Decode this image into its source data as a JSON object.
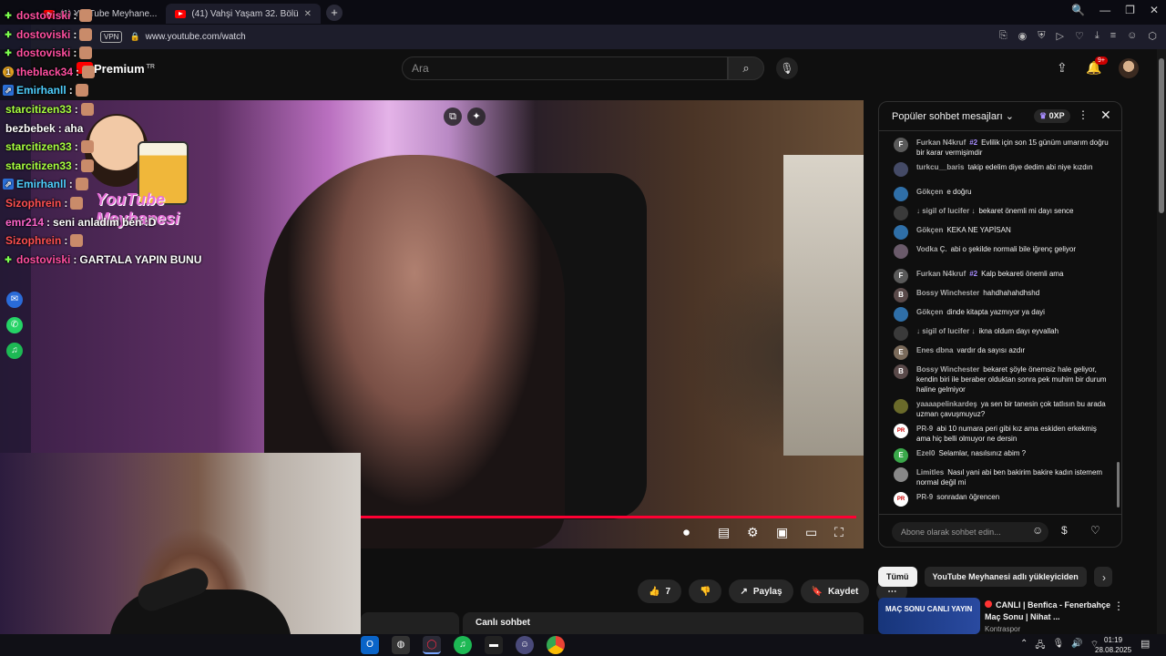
{
  "browser": {
    "tabs": [
      {
        "label": "(1) YouTube Meyhane...",
        "active": false
      },
      {
        "label": "(41) Vahşi Yaşam 32. Bölü",
        "active": true
      }
    ],
    "new_tab": "+",
    "vpn": "VPN",
    "url": "www.youtube.com/watch",
    "window_controls": [
      "🔍",
      "—",
      "❐",
      "✕"
    ]
  },
  "yt_header": {
    "brand": "Premium",
    "region": "TR",
    "search_placeholder": "Ara",
    "notifications_badge": "9+"
  },
  "overlay_chat": [
    {
      "user": "dostoviski",
      "msg": "",
      "color": "#ff4fa0",
      "badge": "plus"
    },
    {
      "user": "dostoviski",
      "msg": "",
      "color": "#ff4fa0",
      "badge": "plus"
    },
    {
      "user": "dostoviski",
      "msg": "",
      "color": "#ff4fa0",
      "badge": "plus"
    },
    {
      "user": "theblack34",
      "msg": "",
      "color": "#ff4fa0",
      "badge": "1"
    },
    {
      "user": "Emirhanll",
      "msg": "",
      "color": "#4fd0ff",
      "badge": "prime"
    },
    {
      "user": "starcitizen33",
      "msg": "",
      "color": "#a8ff40",
      "badge": ""
    },
    {
      "user": "bezbebek",
      "msg": "aha",
      "color": "#ffffff",
      "badge": ""
    },
    {
      "user": "starcitizen33",
      "msg": "",
      "color": "#a8ff40",
      "badge": ""
    },
    {
      "user": "starcitizen33",
      "msg": "",
      "color": "#a8ff40",
      "badge": ""
    },
    {
      "user": "Emirhanll",
      "msg": "",
      "color": "#4fd0ff",
      "badge": "prime"
    },
    {
      "user": "Sizophrein",
      "msg": "",
      "color": "#ff5050",
      "badge": ""
    },
    {
      "user": "emr214",
      "msg": "seni anladım ben :D",
      "color": "#ff66cc",
      "badge": ""
    },
    {
      "user": "Sizophrein",
      "msg": "",
      "color": "#ff5050",
      "badge": ""
    },
    {
      "user": "dostoviski",
      "msg": "GARTALA YAPIN BUNU",
      "color": "#ff4fa0",
      "badge": "plus"
    }
  ],
  "overlay_logo": "YouTube Meyhanesi",
  "video_actions": {
    "like_count": "7",
    "share": "Paylaş",
    "save": "Kaydet",
    "more": "⋯"
  },
  "live_chat_label": "Canlı sohbet",
  "chat": {
    "title": "Popüler sohbet mesajları",
    "xp": "0XP",
    "input_placeholder": "Abone olarak sohbet edin...",
    "messages": [
      {
        "author": "Furkan N4kruf",
        "rank": "#2",
        "text": "Evlilik için son 15 günüm umarım doğru bir karar vermişimdir",
        "initial": "F",
        "color": "#5a5a5a"
      },
      {
        "author": "turkcu__baris",
        "rank": "",
        "text": "takip edelim diye dedim abi niye kızdın",
        "initial": "",
        "color": "#444a66"
      },
      {
        "author": "Gökçen",
        "rank": "",
        "text": "e doğru",
        "initial": "",
        "color": "#2f6fa8"
      },
      {
        "author": "↓ sigil of lucifer ↓",
        "rank": "",
        "text": "bekaret önemli mi dayı sence",
        "initial": "",
        "color": "#3a3a3a"
      },
      {
        "author": "Gökçen",
        "rank": "",
        "text": "KEKA NE YAPİSAN",
        "initial": "",
        "color": "#2f6fa8"
      },
      {
        "author": "Vodka Ç.",
        "rank": "",
        "text": "abi o şekilde normali bile iğrenç geliyor",
        "initial": "",
        "color": "#6a5a6a"
      },
      {
        "author": "Furkan N4kruf",
        "rank": "#2",
        "text": "Kalp bekareti önemli ama",
        "initial": "F",
        "color": "#5a5a5a"
      },
      {
        "author": "Bossy Winchester",
        "rank": "",
        "text": "hahdhahahdhshd",
        "initial": "B",
        "color": "#5a4a4a"
      },
      {
        "author": "Gökçen",
        "rank": "",
        "text": "dinde kitapta yazmıyor ya dayi",
        "initial": "",
        "color": "#2f6fa8"
      },
      {
        "author": "↓ sigil of lucifer ↓",
        "rank": "",
        "text": "ikna oldum dayı eyvallah",
        "initial": "",
        "color": "#3a3a3a"
      },
      {
        "author": "Enes dbna",
        "rank": "",
        "text": "vardır da sayısı azdır",
        "initial": "E",
        "color": "#7a6a5a"
      },
      {
        "author": "Bossy Winchester",
        "rank": "",
        "text": "bekaret şöyle önemsiz hale geliyor, kendin biri ile beraber olduktan sonra pek muhim bir durum haline gelmiyor",
        "initial": "B",
        "color": "#5a4a4a"
      },
      {
        "author": "yaaaapelinkardeş",
        "rank": "",
        "text": "ya sen bir tanesin çok tatlısın bu arada uzman çavuşmuyuz?",
        "initial": "",
        "color": "#6a6a2a"
      },
      {
        "author": "PR-9",
        "rank": "",
        "text": "abi 10 numara peri gibi kız ama eskiden erkekmiş ama hiç belli olmuyor ne dersin",
        "initial": "PR",
        "color": "#ffffff"
      },
      {
        "author": "Ezel0",
        "rank": "",
        "text": "Selamlar, nasılsınız abim ?",
        "initial": "E",
        "color": "#3aa84a"
      },
      {
        "author": "Limitles",
        "rank": "",
        "text": "Nasıl yani abi ben bakirim bakire kadın istemem normal değil mi",
        "initial": "",
        "color": "#888888"
      },
      {
        "author": "PR-9",
        "rank": "",
        "text": "sonradan öğrencen",
        "initial": "PR",
        "color": "#ffffff"
      }
    ]
  },
  "chips": [
    {
      "label": "Tümü",
      "active": true
    },
    {
      "label": "YouTube Meyhanesi adlı yükleyiciden",
      "active": false
    },
    {
      "label": "",
      "active": false
    }
  ],
  "related": {
    "thumb_text": "MAÇ SONU CANLI YAYIN",
    "live_label": "CANLI",
    "title": "Benfica - Fenerbahçe Maç Sonu | Nihat ...",
    "channel": "Kontraspor"
  },
  "taskbar": {
    "time": "01:19",
    "date": "28.08.2025"
  },
  "colors": {
    "accent_red": "#ff0033",
    "chat_rank": "#a88dff"
  }
}
